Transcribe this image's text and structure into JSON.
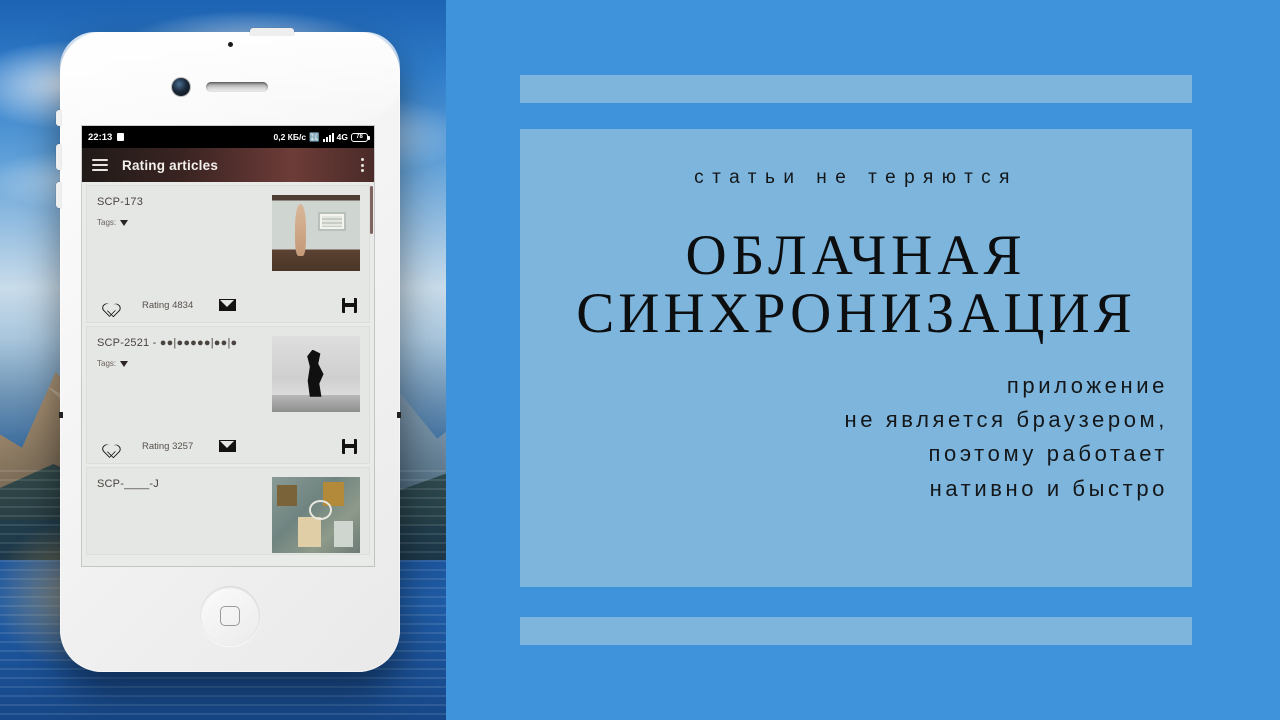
{
  "slide": {
    "eyebrow": "статьи не теряются",
    "headline_line1": "ОБЛАЧНАЯ",
    "headline_line2": "СИНХРОНИЗАЦИЯ",
    "body_line1": "приложение",
    "body_line2": "не является браузером,",
    "body_line3": "поэтому работает",
    "body_line4": "нативно и быстро",
    "colors": {
      "background_blue": "#3f93db",
      "panel_blue": "#7db5dc",
      "text_dark": "#14171a"
    }
  },
  "phone": {
    "status_bar": {
      "time": "22:13",
      "net_speed": "0,2 КБ/с",
      "network": "4G",
      "battery_percent": "78"
    },
    "app_bar": {
      "title": "Rating articles",
      "menu_icon": "hamburger-icon",
      "overflow_icon": "kebab-menu-icon"
    },
    "articles": [
      {
        "title": "SCP-173",
        "tags_label": "Tags:",
        "rating": "Rating 4834",
        "favorite_icon": "heart-icon",
        "mail_icon": "envelope-icon",
        "save_icon": "floppy-save-icon"
      },
      {
        "title": "SCP-2521 - ●●|●●●●●|●●|●",
        "tags_label": "Tags:",
        "rating": "Rating 3257",
        "favorite_icon": "heart-icon",
        "mail_icon": "envelope-icon",
        "save_icon": "floppy-save-icon"
      },
      {
        "title": "SCP-____-J",
        "tags_label": "",
        "rating": "",
        "favorite_icon": "",
        "mail_icon": "",
        "save_icon": ""
      }
    ]
  }
}
